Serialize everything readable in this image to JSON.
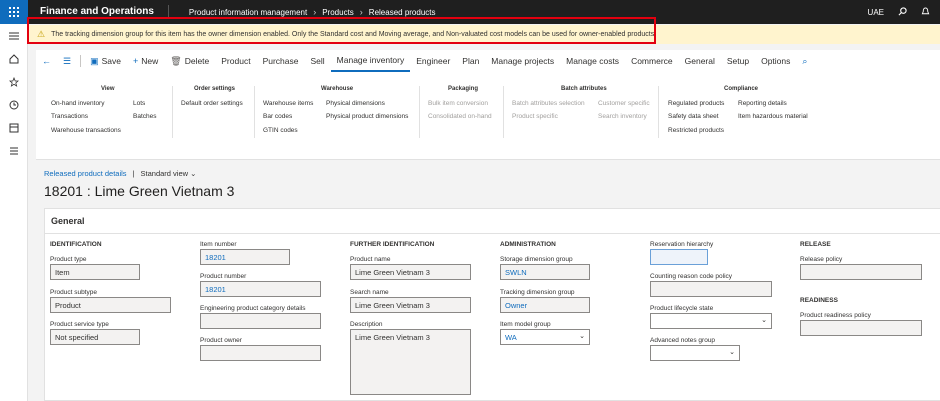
{
  "topbar": {
    "app_title": "Finance and Operations",
    "crumbs": [
      "Product information management",
      "Products",
      "Released products"
    ],
    "company": "UAE"
  },
  "banner": {
    "message": "The tracking dimension group for this item has the owner dimension enabled. Only the Standard cost and Moving average, and Non-valuated cost models can be used for owner-enabled products."
  },
  "actionbar": {
    "save": "Save",
    "new": "New",
    "delete": "Delete",
    "tabs": [
      "Product",
      "Purchase",
      "Sell",
      "Manage inventory",
      "Engineer",
      "Plan",
      "Manage projects",
      "Manage costs",
      "Commerce",
      "General",
      "Setup",
      "Options"
    ]
  },
  "ribbon": {
    "view": {
      "title": "View",
      "items": [
        "On-hand inventory",
        "Transactions",
        "Warehouse transactions",
        "Lots",
        "Batches"
      ]
    },
    "order": {
      "title": "Order settings",
      "items": [
        "Default order settings"
      ]
    },
    "warehouse": {
      "title": "Warehouse",
      "items": [
        "Warehouse items",
        "Bar codes",
        "GTIN codes",
        "Physical dimensions",
        "Physical product dimensions"
      ]
    },
    "packaging": {
      "title": "Packaging",
      "items": [
        "Bulk item conversion",
        "Consolidated on-hand"
      ]
    },
    "batch": {
      "title": "Batch attributes",
      "items": [
        "Batch attributes selection",
        "Product specific",
        "Customer specific",
        "Search inventory"
      ]
    },
    "compliance": {
      "title": "Compliance",
      "items": [
        "Regulated products",
        "Safety data sheet",
        "Restricted products",
        "Reporting details",
        "Item hazardous material"
      ]
    }
  },
  "page": {
    "breadcrumb": "Released product details",
    "view": "Standard view",
    "title": "18201 : Lime Green Vietnam 3"
  },
  "general": {
    "title": "General",
    "identification": {
      "title": "IDENTIFICATION",
      "product_type_label": "Product type",
      "product_type": "Item",
      "product_subtype_label": "Product subtype",
      "product_subtype": "Product",
      "service_type_label": "Product service type",
      "service_type": "Not specified"
    },
    "numbers": {
      "item_number_label": "Item number",
      "item_number": "18201",
      "product_number_label": "Product number",
      "product_number": "18201",
      "eng_category_label": "Engineering product category details",
      "eng_category": "",
      "owner_label": "Product owner",
      "owner": ""
    },
    "further": {
      "title": "FURTHER IDENTIFICATION",
      "product_name_label": "Product name",
      "product_name": "Lime Green Vietnam 3",
      "search_name_label": "Search name",
      "search_name": "Lime Green Vietnam 3",
      "description_label": "Description",
      "description": "Lime Green Vietnam 3"
    },
    "administration": {
      "title": "ADMINISTRATION",
      "storage_label": "Storage dimension group",
      "storage": "SWLN",
      "tracking_label": "Tracking dimension group",
      "tracking": "Owner",
      "model_label": "Item model group",
      "model": "WA"
    },
    "reservation": {
      "hierarchy_label": "Reservation hierarchy",
      "hierarchy": "",
      "counting_label": "Counting reason code policy",
      "counting": "",
      "lifecycle_label": "Product lifecycle state",
      "lifecycle": "",
      "notes_label": "Advanced notes group",
      "notes": ""
    },
    "release": {
      "title": "RELEASE",
      "policy_label": "Release policy",
      "policy": "",
      "readiness_title": "READINESS",
      "readiness_label": "Product readiness policy",
      "readiness": ""
    }
  }
}
